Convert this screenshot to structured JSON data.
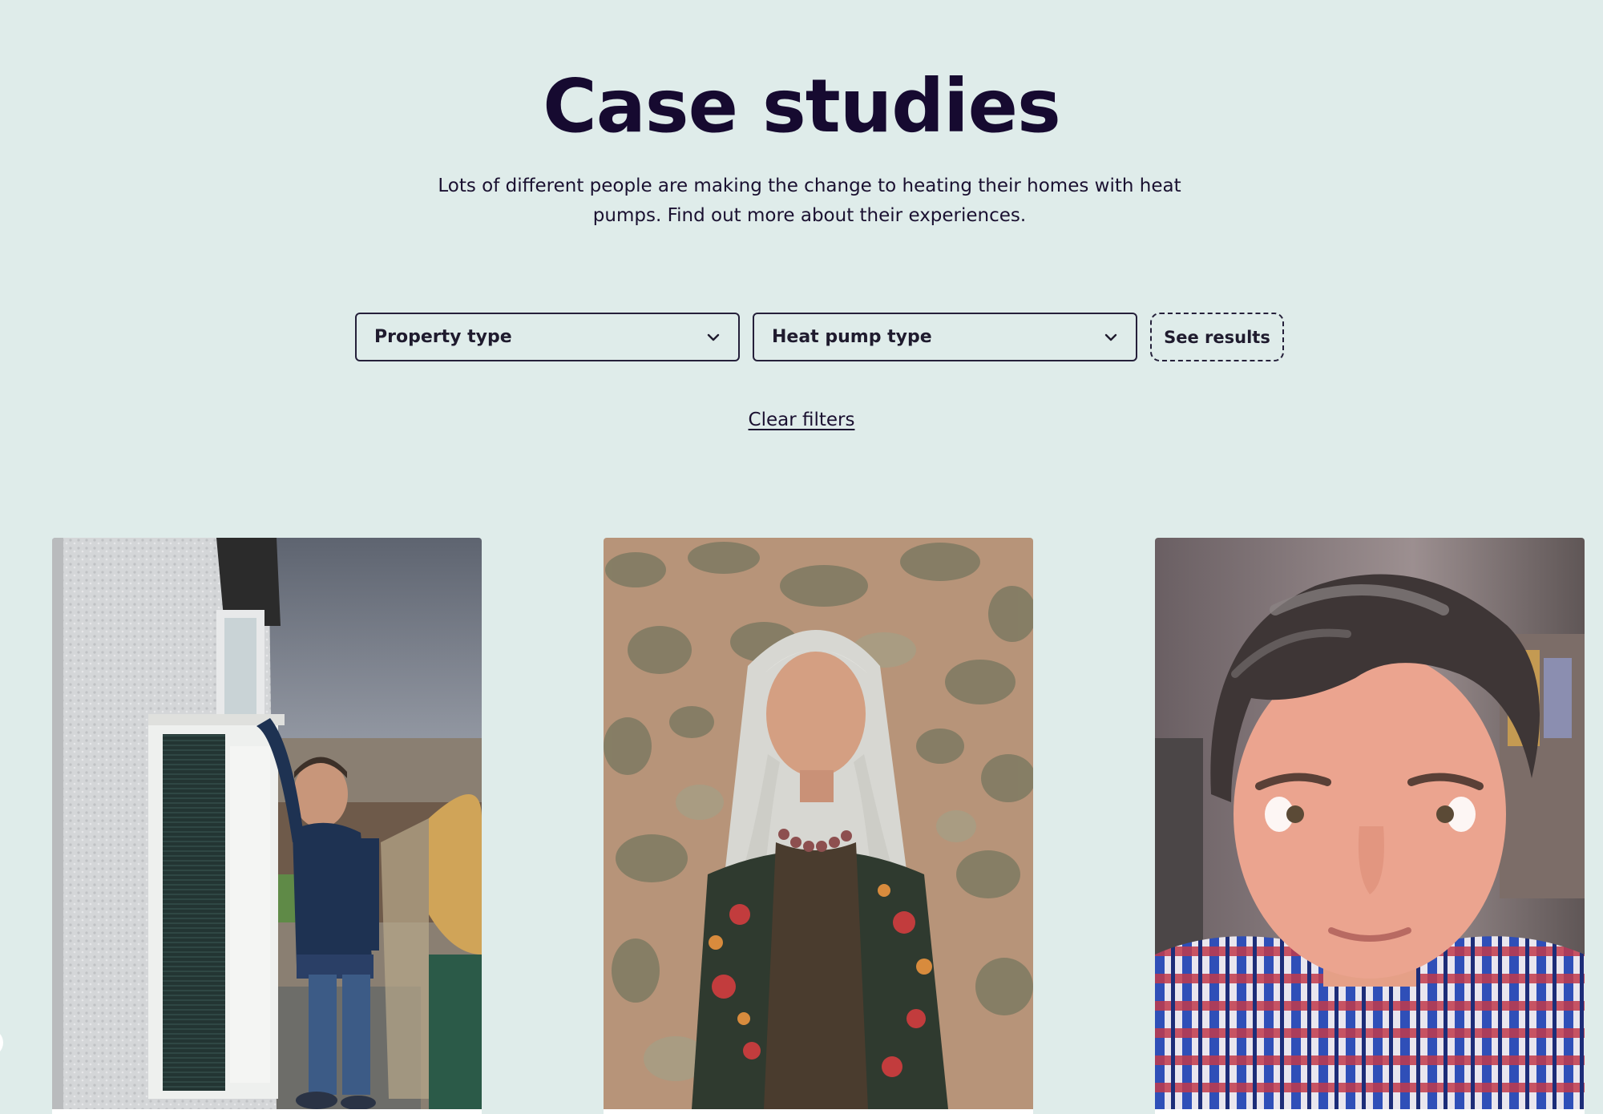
{
  "header": {
    "title": "Case studies",
    "intro": "Lots of different people are making the change to heating their homes with heat pumps. Find out more about their experiences."
  },
  "filters": {
    "property_type": {
      "label": "Property type",
      "icon": "chevron-down-icon"
    },
    "heat_pump_type": {
      "label": "Heat pump type",
      "icon": "chevron-down-icon"
    },
    "submit_label": "See results",
    "clear_label": "Clear filters"
  },
  "cards": [
    {
      "photo": "man-beside-heat-pump-photo"
    },
    {
      "photo": "woman-in-front-of-stone-wall-photo"
    },
    {
      "photo": "man-selfie-photo"
    }
  ],
  "colors": {
    "background": "#dfecea",
    "text": "#14082b",
    "border": "#25203a"
  }
}
